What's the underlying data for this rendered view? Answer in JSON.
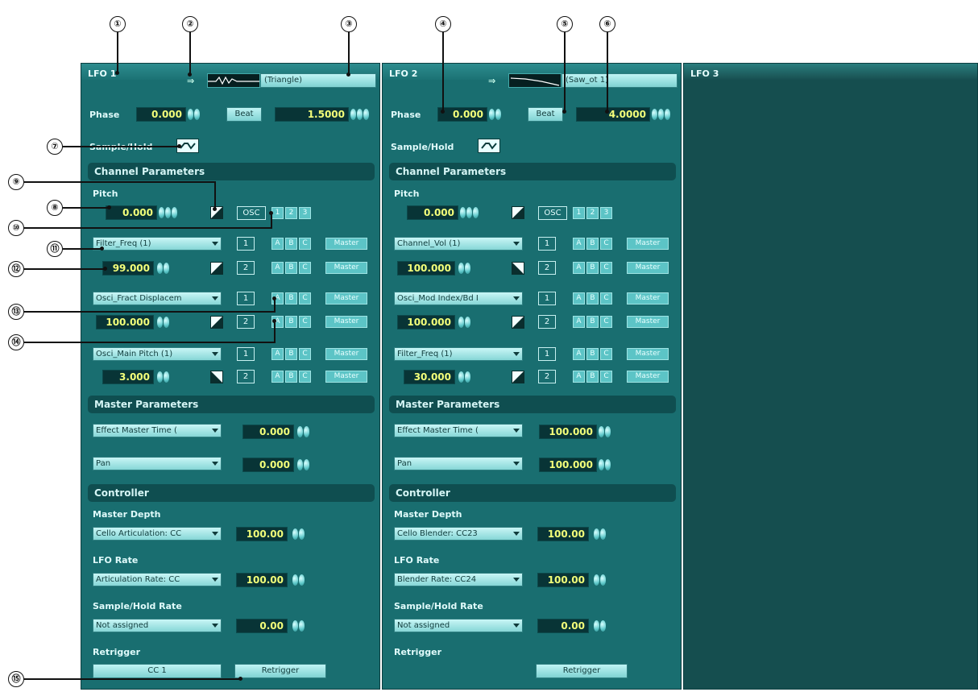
{
  "lfo1": {
    "title": "LFO 1",
    "waveform": "(Triangle)",
    "phase_label": "Phase",
    "phase": "0.000",
    "beat_label": "Beat",
    "rate": "1.5000",
    "sample_hold_label": "Sample/Hold",
    "channel_params_label": "Channel Parameters",
    "pitch_label": "Pitch",
    "pitch": "0.000",
    "osc_label": "OSC",
    "osc_slots": [
      "1",
      "2",
      "3"
    ],
    "rows": [
      {
        "param": "Filter_Freq (1)",
        "value": "99.000"
      },
      {
        "param": "Osci_Fract Displacem",
        "value": "100.000"
      },
      {
        "param": "Osci_Main Pitch (1)",
        "value": "3.000"
      }
    ],
    "slot_labels": [
      "1",
      "2"
    ],
    "abc": [
      "A",
      "B",
      "C"
    ],
    "master_btn": "Master",
    "master_params_label": "Master Parameters",
    "master_rows": [
      {
        "param": "Effect Master Time (",
        "value": "0.000"
      },
      {
        "param": "Pan",
        "value": "0.000"
      }
    ],
    "controller_label": "Controller",
    "master_depth_label": "Master Depth",
    "master_depth_cc": "Cello Articulation: CC",
    "master_depth_value": "100.00",
    "lfo_rate_label": "LFO Rate",
    "lfo_rate_cc": "Articulation Rate: CC",
    "lfo_rate_value": "100.00",
    "sh_rate_label": "Sample/Hold Rate",
    "sh_rate_cc": "Not assigned",
    "sh_rate_value": "0.00",
    "retrigger_label": "Retrigger",
    "retrigger_cc": "CC 1",
    "retrigger_btn": "Retrigger"
  },
  "lfo2": {
    "title": "LFO 2",
    "waveform": "(Saw_ot 1)",
    "phase_label": "Phase",
    "phase": "0.000",
    "beat_label": "Beat",
    "rate": "4.0000",
    "sample_hold_label": "Sample/Hold",
    "channel_params_label": "Channel Parameters",
    "pitch_label": "Pitch",
    "pitch": "0.000",
    "osc_label": "OSC",
    "osc_slots": [
      "1",
      "2",
      "3"
    ],
    "rows": [
      {
        "param": "Channel_Vol (1)",
        "value": "100.000"
      },
      {
        "param": "Osci_Mod Index/Bd I",
        "value": "100.000"
      },
      {
        "param": "Filter_Freq (1)",
        "value": "30.000"
      }
    ],
    "slot_labels": [
      "1",
      "2"
    ],
    "abc": [
      "A",
      "B",
      "C"
    ],
    "master_btn": "Master",
    "master_params_label": "Master Parameters",
    "master_rows": [
      {
        "param": "Effect Master Time (",
        "value": "100.000"
      },
      {
        "param": "Pan",
        "value": "100.000"
      }
    ],
    "controller_label": "Controller",
    "master_depth_label": "Master Depth",
    "master_depth_cc": "Cello Blender: CC23",
    "master_depth_value": "100.00",
    "lfo_rate_label": "LFO Rate",
    "lfo_rate_cc": "Blender Rate: CC24",
    "lfo_rate_value": "100.00",
    "sh_rate_label": "Sample/Hold Rate",
    "sh_rate_cc": "Not assigned",
    "sh_rate_value": "0.00",
    "retrigger_label": "Retrigger",
    "retrigger_btn": "Retrigger"
  },
  "lfo3": {
    "title": "LFO 3"
  },
  "callouts": [
    "①",
    "②",
    "③",
    "④",
    "⑤",
    "⑥",
    "⑦",
    "⑧",
    "⑨",
    "⑩",
    "⑪",
    "⑫",
    "⑬",
    "⑭",
    "⑮"
  ],
  "colors": {
    "panel": "#196e70",
    "section": "#0f4e50",
    "value_text": "#f3ff7a",
    "button": "#8fdada"
  }
}
